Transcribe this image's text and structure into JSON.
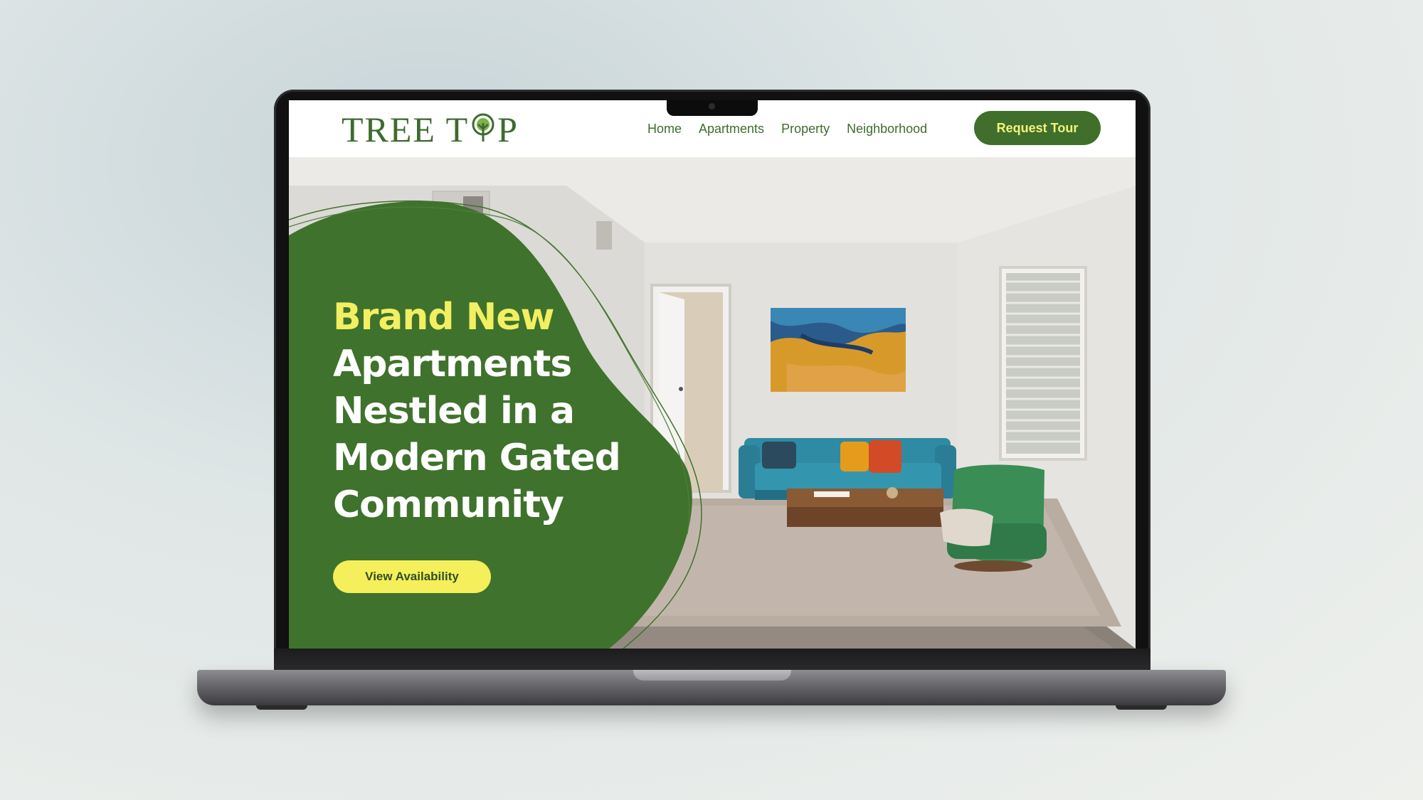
{
  "site": {
    "logo_text_left": "TREE T",
    "logo_text_right": "P"
  },
  "nav": {
    "items": [
      {
        "label": "Home"
      },
      {
        "label": "Apartments"
      },
      {
        "label": "Property"
      },
      {
        "label": "Neighborhood"
      }
    ],
    "cta_label": "Request Tour"
  },
  "hero": {
    "headline_accent": "Brand New",
    "headline_lines": [
      "Apartments",
      "Nestled in a",
      "Modern Gated",
      "Community"
    ],
    "button_label": "View Availability"
  },
  "colors": {
    "brand_green": "#3f6f2b",
    "accent_yellow": "#f2ef63",
    "hero_green": "#3f722c"
  },
  "icons": {
    "logo_mark": "tree-icon"
  }
}
